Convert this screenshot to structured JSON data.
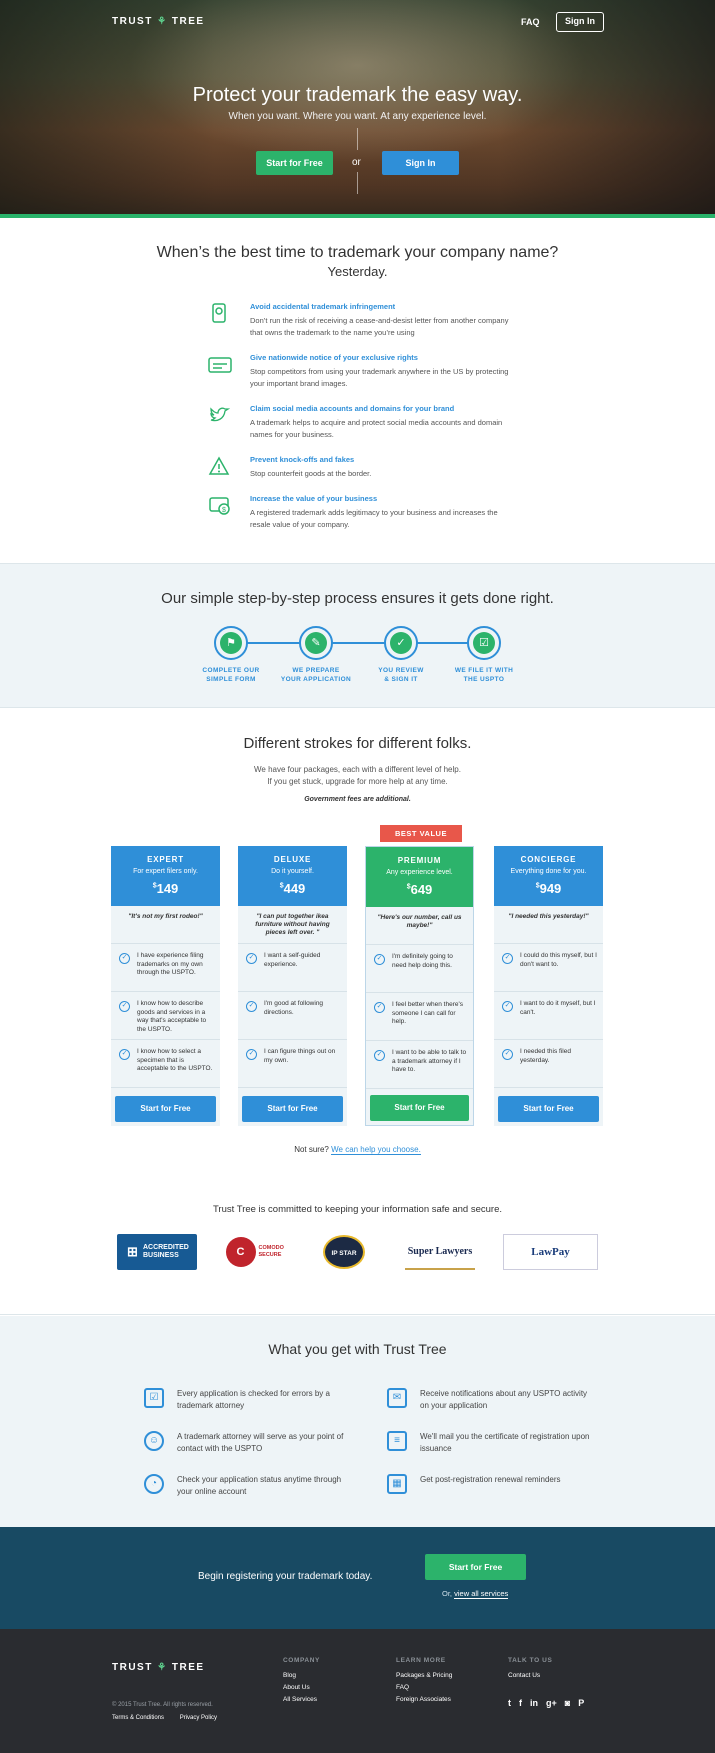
{
  "header": {
    "logo": "TRUST",
    "logo_tree": "TREE",
    "faq": "FAQ",
    "signin": "Sign In"
  },
  "hero": {
    "title": "Protect your trademark the easy way.",
    "subtitle": "When you want. Where you want. At any experience level.",
    "start_btn": "Start for Free",
    "or": "or",
    "signin_btn": "Sign In"
  },
  "when": {
    "title": "When’s the best time to trademark your company name?",
    "answer": "Yesterday.",
    "features": [
      {
        "icon": "shield-icon",
        "title": "Avoid accidental trademark infringement",
        "desc": "Don’t run the risk of receiving a cease-and-desist letter from another company that owns the trademark to the name you’re using"
      },
      {
        "icon": "id-card-icon",
        "title": "Give nationwide notice of your exclusive rights",
        "desc": "Stop competitors from using your trademark anywhere in the US by protecting your important brand images."
      },
      {
        "icon": "bird-icon",
        "title": "Claim social media accounts and domains for your brand",
        "desc": "A trademark helps to acquire and protect social media accounts and domain names for your business."
      },
      {
        "icon": "warning-icon",
        "title": "Prevent knock-offs and fakes",
        "desc": "Stop counterfeit goods at the border."
      },
      {
        "icon": "money-icon",
        "title": "Increase the value of your business",
        "desc": "A registered trademark adds legitimacy to your business and increases the resale value of your company."
      }
    ]
  },
  "process": {
    "title": "Our simple step-by-step process ensures it gets done right.",
    "steps": [
      {
        "l1": "COMPLETE OUR",
        "l2": "SIMPLE FORM",
        "icon": "flag-icon"
      },
      {
        "l1": "WE PREPARE",
        "l2": "YOUR APPLICATION",
        "icon": "clipboard-icon"
      },
      {
        "l1": "YOU REVIEW",
        "l2": "& SIGN IT",
        "icon": "thumbs-up-icon"
      },
      {
        "l1": "WE FILE IT WITH",
        "l2": "THE USPTO",
        "icon": "document-icon"
      }
    ]
  },
  "pricing": {
    "title": "Different strokes for different folks.",
    "line1": "We have four packages, each with a different level of help.",
    "line2": "If you get stuck, upgrade for more help at any time.",
    "gov": "Government fees are additional.",
    "best_value": "BEST VALUE",
    "plans": [
      {
        "name": "EXPERT",
        "tag": "For expert filers only.",
        "price": "149",
        "quote": "\"It's not my first rodeo!\"",
        "items": [
          "I have experience filing trademarks on my own through the USPTO.",
          "I know how to describe goods and services in a way that's acceptable to the USPTO.",
          "I know how to select a specimen that is acceptable to the USPTO."
        ],
        "cta": "Start for Free"
      },
      {
        "name": "DELUXE",
        "tag": "Do it yourself.",
        "price": "449",
        "quote": "\"I can put together ikea furniture without having pieces left over. \"",
        "items": [
          "I want a self-guided experience.",
          "I'm good at following directions.",
          "I can figure things out on my own."
        ],
        "cta": "Start for Free"
      },
      {
        "name": "PREMIUM",
        "tag": "Any experience level.",
        "price": "649",
        "quote": "\"Here's our number, call us maybe!\"",
        "items": [
          "I'm definitely going to need help doing this.",
          "I feel better when there's someone I can call for help.",
          "I want to be able to talk to a trademark attorney if I have to."
        ],
        "cta": "Start for Free"
      },
      {
        "name": "CONCIERGE",
        "tag": "Everything done for you.",
        "price": "949",
        "quote": "\"I needed this yesterday!\"",
        "items": [
          "I could do this myself, but I don't want to.",
          "I want to do it myself, but I can't.",
          "I needed this filed yesterday."
        ],
        "cta": "Start for Free"
      }
    ],
    "not_sure": "Not sure?",
    "help_link": "We can help you choose.",
    "secure": "Trust Tree is committed to keeping your information safe and secure.",
    "logos": [
      "ACCREDITED BUSINESS",
      "COMODO SECURE",
      "IP STAR",
      "Super Lawyers",
      "LawPay"
    ]
  },
  "get": {
    "title": "What you get with Trust Tree",
    "items": [
      {
        "icon": "checklist-icon",
        "text": "Every application is checked for errors by a trademark attorney"
      },
      {
        "icon": "mail-icon",
        "text": "Receive notifications about any USPTO activity on your application"
      },
      {
        "icon": "person-icon",
        "text": "A trademark attorney will serve as your point of contact with the USPTO"
      },
      {
        "icon": "certificate-icon",
        "text": "We'll mail you the certificate of registration upon issuance"
      },
      {
        "icon": "gauge-icon",
        "text": "Check your application status anytime through your online account"
      },
      {
        "icon": "calendar-icon",
        "text": "Get post-registration renewal reminders"
      }
    ]
  },
  "cta": {
    "msg": "Begin registering your trademark today.",
    "btn": "Start for Free",
    "or": "Or,",
    "link": "view all services"
  },
  "footer": {
    "copy": "© 2015 Trust Tree. All rights reserved.",
    "terms": "Terms & Conditions",
    "privacy": "Privacy Policy",
    "company": {
      "h": "COMPANY",
      "links": [
        "Blog",
        "About Us",
        "All Services"
      ]
    },
    "learn": {
      "h": "LEARN MORE",
      "links": [
        "Packages & Pricing",
        "FAQ",
        "Foreign Associates"
      ]
    },
    "talk": {
      "h": "TALK TO US",
      "links": [
        "Contact Us"
      ]
    },
    "social": [
      "twitter-icon",
      "facebook-icon",
      "linkedin-icon",
      "google-plus-icon",
      "instagram-icon",
      "pinterest-icon"
    ]
  }
}
